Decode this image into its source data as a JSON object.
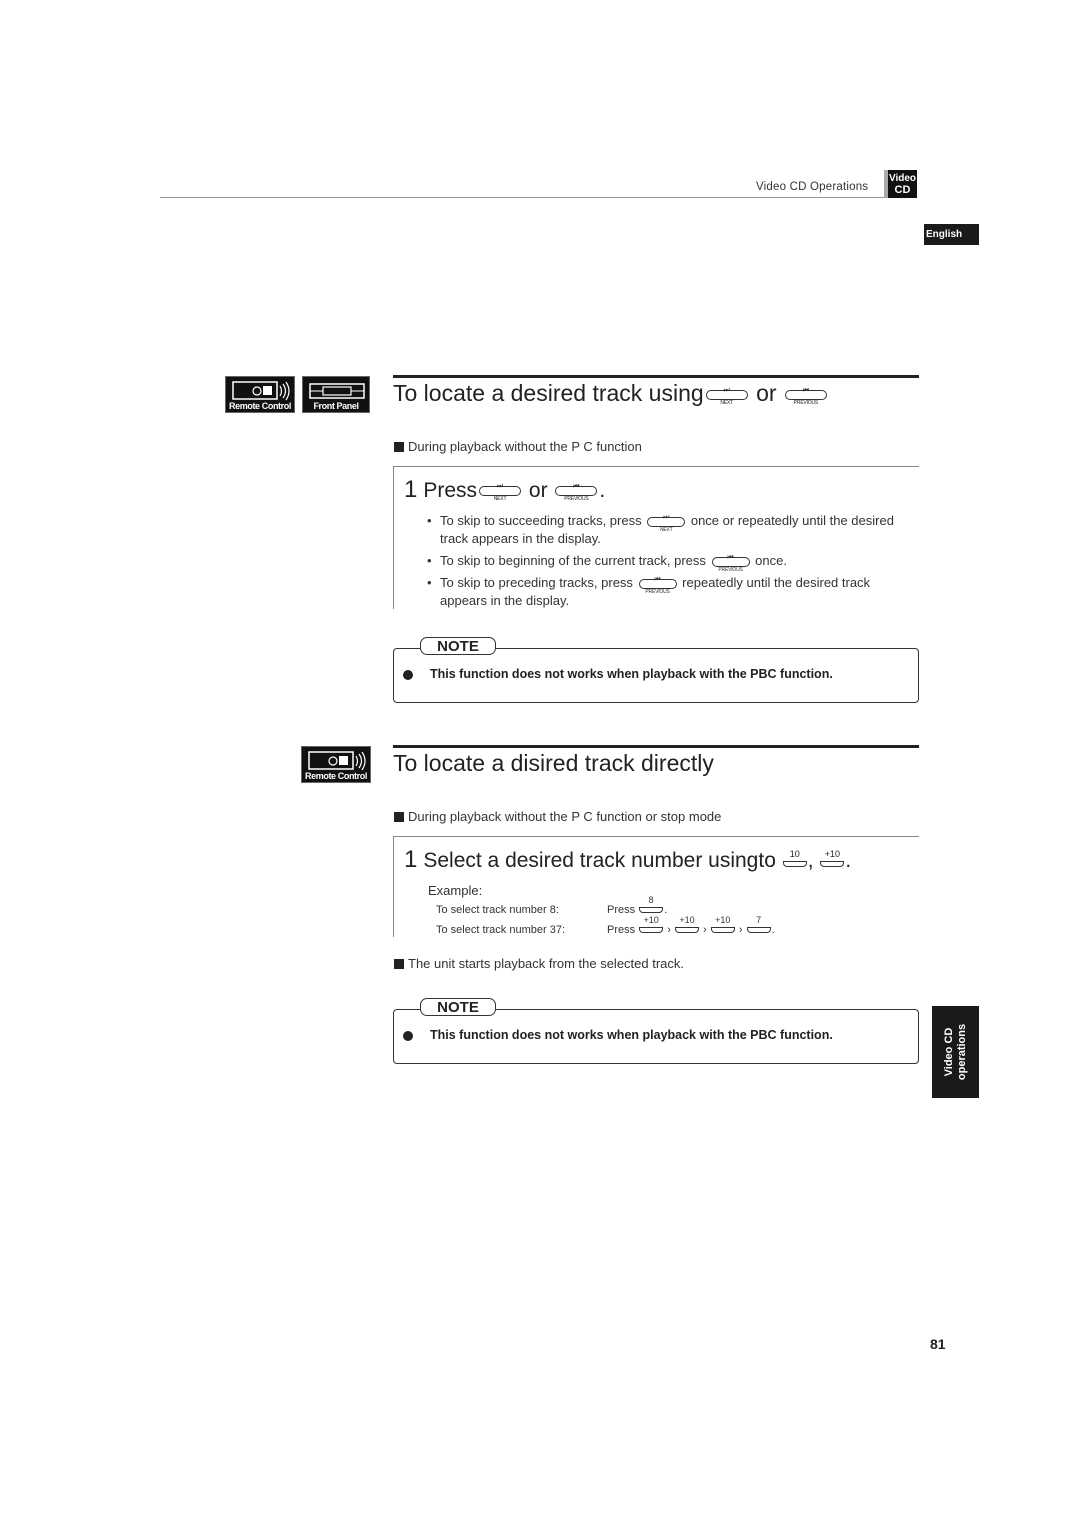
{
  "header": {
    "section_label": "Video CD Operations",
    "logo": {
      "line1": "Video",
      "line2": "CD"
    },
    "language_tab": "English"
  },
  "badges": {
    "remote_control": "Remote Control",
    "front_panel": "Front Panel"
  },
  "section1": {
    "title": "To locate a desired track using",
    "title_or": "or",
    "condition": "During playback without the P  C function",
    "step": {
      "number": "1",
      "text_before": "Press",
      "text_or": "or",
      "text_end": "."
    },
    "bullets": [
      {
        "before": "To skip to succeeding tracks, press",
        "key": "next",
        "after": "once or repeatedly until the desired track appears in the display."
      },
      {
        "before": "To skip to beginning of the current track, press",
        "key": "previous",
        "after": "once."
      },
      {
        "before": "To skip to preceding tracks, press",
        "key": "previous",
        "after": "repeatedly until the desired track appears in the display."
      }
    ],
    "note": {
      "label": "NOTE",
      "text": "This function does not works when playback with the PBC function."
    }
  },
  "keys": {
    "next": {
      "glyph": "⏭",
      "label": "NEXT"
    },
    "previous": {
      "glyph": "⏮",
      "label": "PREVIOUS"
    }
  },
  "section2": {
    "title": "To locate a disired track directly",
    "condition": "During playback without the P  C function or stop mode",
    "step": {
      "number": "1",
      "text": "Select a desired track number usingto",
      "key1": "10",
      "sep": ",",
      "key2": "+10",
      "end": "."
    },
    "example": {
      "label": "Example:",
      "rows": [
        {
          "desc": "To select track number 8:",
          "press": "Press",
          "keys": [
            "8"
          ]
        },
        {
          "desc": "To select track number 37:",
          "press": "Press",
          "keys": [
            "+10",
            "+10",
            "+10",
            "7"
          ]
        }
      ],
      "arrow": "›"
    },
    "result": "The unit starts playback from the selected track.",
    "note": {
      "label": "NOTE",
      "text": "This function does not works when playback with the PBC function."
    }
  },
  "side_tab": {
    "line1": "Video CD",
    "line2": "operations"
  },
  "page_number": "81"
}
